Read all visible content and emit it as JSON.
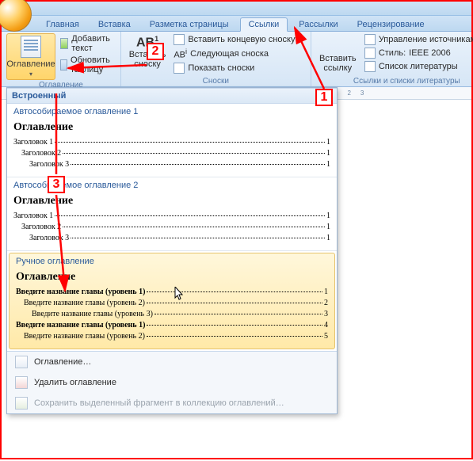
{
  "tabs": {
    "home": "Главная",
    "insert": "Вставка",
    "layout": "Разметка страницы",
    "references": "Ссылки",
    "mailings": "Рассылки",
    "review": "Рецензирование"
  },
  "ribbon": {
    "toc": {
      "label": "Оглавление",
      "add_text": "Добавить текст",
      "update_table": "Обновить таблицу"
    },
    "footnote": {
      "insert": "Вставить сноску",
      "grouplabel": "Сноски",
      "ab_sup": "1",
      "abi_sup": "i",
      "end": "Вставить концевую сноску",
      "next": "Следующая сноска",
      "show": "Показать сноски"
    },
    "citation": {
      "insert": "Вставить ссылку",
      "manage": "Управление источниками",
      "style_label": "Стиль:",
      "style_value": "IEEE 2006",
      "biblio": "Список литературы",
      "grouplabel": "Ссылки и списки литературы"
    }
  },
  "gallery": {
    "built_in": "Встроенный",
    "auto1": {
      "title": "Автособираемое оглавление 1",
      "heading": "Оглавление",
      "lines": [
        {
          "txt": "Заголовок 1",
          "pg": "1"
        },
        {
          "txt": "Заголовок 2",
          "pg": "1"
        },
        {
          "txt": "Заголовок 3",
          "pg": "1"
        }
      ]
    },
    "auto2": {
      "title": "Автособираемое оглавление 2",
      "heading": "Оглавление",
      "lines": [
        {
          "txt": "Заголовок 1",
          "pg": "1"
        },
        {
          "txt": "Заголовок 2",
          "pg": "1"
        },
        {
          "txt": "Заголовок 3",
          "pg": "1"
        }
      ]
    },
    "manual": {
      "title": "Ручное оглавление",
      "heading": "Оглавление",
      "lines": [
        {
          "txt": "Введите название главы (уровень 1)",
          "pg": "1",
          "level": 0,
          "bold": true
        },
        {
          "txt": "Введите название главы (уровень 2)",
          "pg": "2",
          "level": 1,
          "bold": false
        },
        {
          "txt": "Введите название главы (уровень 3)",
          "pg": "3",
          "level": 2,
          "bold": false
        },
        {
          "txt": "Введите название главы (уровень 1)",
          "pg": "4",
          "level": 0,
          "bold": true
        },
        {
          "txt": "Введите название главы (уровень 2)",
          "pg": "5",
          "level": 1,
          "bold": false
        }
      ]
    },
    "menu": {
      "custom": "Оглавление…",
      "remove": "Удалить оглавление",
      "save": "Сохранить выделенный фрагмент в коллекцию оглавлений…"
    }
  },
  "ruler": {
    "r1": "1",
    "r2": "2",
    "r3": "3"
  },
  "callouts": {
    "c1": "1",
    "c2": "2",
    "c3": "3"
  }
}
